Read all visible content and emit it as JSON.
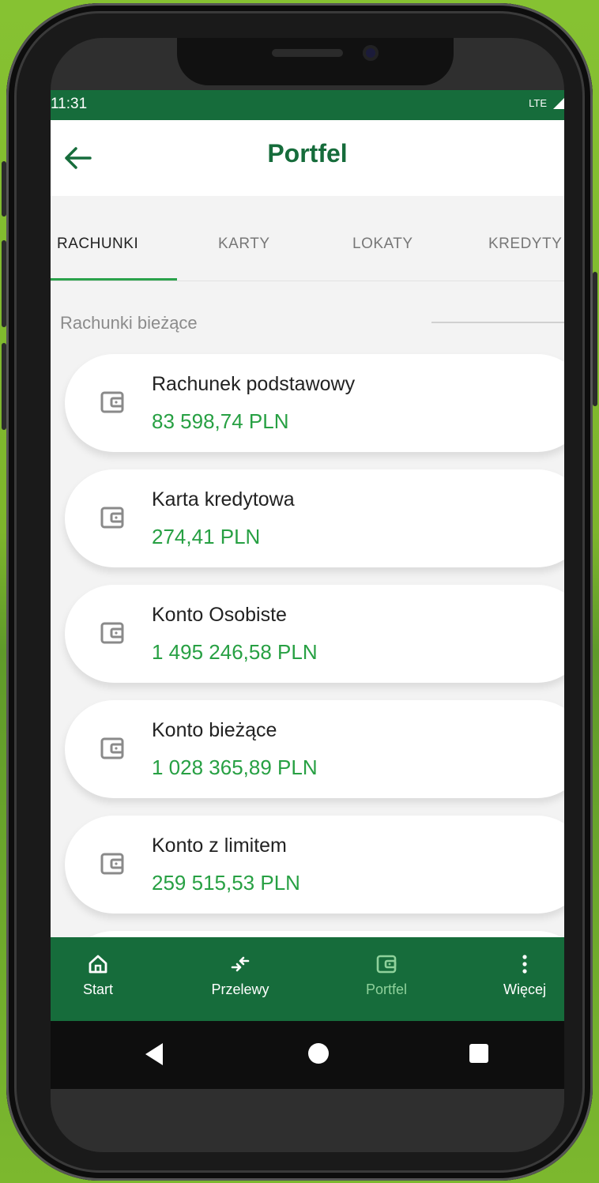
{
  "status_bar": {
    "time": "11:31",
    "network": "LTE"
  },
  "header": {
    "title": "Portfel",
    "back_icon": "arrow-left-icon"
  },
  "tabs": [
    {
      "label": "RACHUNKI",
      "active": true
    },
    {
      "label": "KARTY",
      "active": false
    },
    {
      "label": "LOKATY",
      "active": false
    },
    {
      "label": "KREDYTY",
      "active": false
    }
  ],
  "section": {
    "title": "Rachunki bieżące"
  },
  "accounts": [
    {
      "name": "Rachunek podstawowy",
      "amount": "83 598,74 PLN",
      "icon": "wallet-icon"
    },
    {
      "name": "Karta kredytowa",
      "amount": "274,41 PLN",
      "icon": "wallet-icon"
    },
    {
      "name": "Konto Osobiste",
      "amount": "1 495 246,58 PLN",
      "icon": "wallet-icon"
    },
    {
      "name": "Konto bieżące",
      "amount": "1 028 365,89 PLN",
      "icon": "wallet-icon"
    },
    {
      "name": "Konto z limitem",
      "amount": "259 515,53 PLN",
      "icon": "wallet-icon"
    }
  ],
  "bottom_nav": [
    {
      "label": "Start",
      "icon": "home-icon"
    },
    {
      "label": "Przelewy",
      "icon": "transfer-arrows-icon"
    },
    {
      "label": "Portfel",
      "icon": "wallet-icon",
      "active": true
    },
    {
      "label": "Więcej",
      "icon": "more-vertical-icon"
    }
  ],
  "colors": {
    "brand_green": "#166c3b",
    "amount_green": "#27a043",
    "active_tab_underline": "#2aa24b"
  }
}
